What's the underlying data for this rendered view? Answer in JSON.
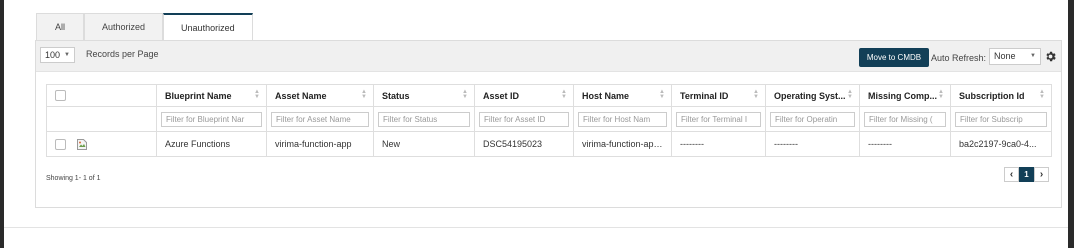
{
  "tabs": [
    {
      "label": "All",
      "active": false
    },
    {
      "label": "Authorized",
      "active": false
    },
    {
      "label": "Unauthorized",
      "active": true
    }
  ],
  "toolbar": {
    "per_page_value": "100",
    "per_page_label": "Records per Page",
    "move_button": "Move to CMDB",
    "auto_refresh_label": "Auto Refresh:",
    "auto_refresh_value": "None",
    "settings_icon": "gear-icon"
  },
  "table": {
    "columns": [
      "Blueprint Name",
      "Asset Name",
      "Status",
      "Asset ID",
      "Host Name",
      "Terminal ID",
      "Operating Syst...",
      "Missing Comp...",
      "Subscription Id"
    ],
    "filters": [
      "Filter for Blueprint Nar",
      "Filter for Asset Name",
      "Filter for Status",
      "Filter for Asset ID",
      "Filter for Host Nam",
      "Filter for Terminal I",
      "Filter for Operatin",
      "Filter for Missing (",
      "Filter for Subscrip"
    ],
    "rows": [
      [
        "Azure Functions",
        "virima-function-app",
        "New",
        "DSC54195023",
        "virima-function-app...",
        "--------",
        "--------",
        "--------",
        "ba2c2197-9ca0-4..."
      ]
    ]
  },
  "footer": {
    "showing": "Showing 1- 1 of 1",
    "prev": "‹",
    "page": "1",
    "next": "›"
  },
  "colors": {
    "accent": "#123f57"
  }
}
